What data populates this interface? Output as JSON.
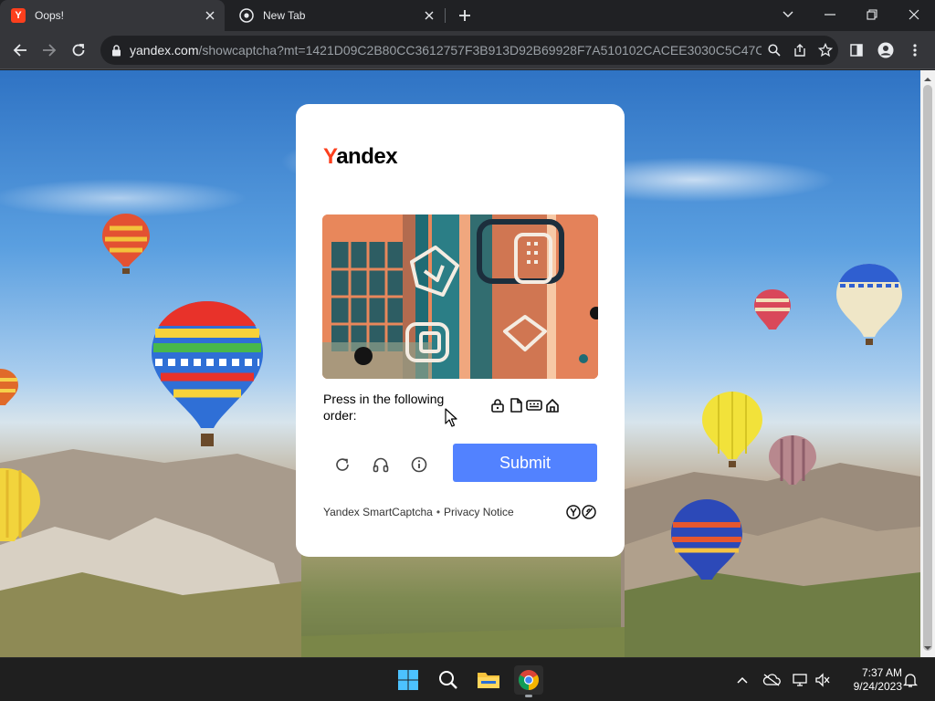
{
  "browser": {
    "tabs": [
      {
        "title": "Oops!",
        "favicon": "yandex-favicon",
        "active": true
      },
      {
        "title": "New Tab",
        "favicon": "chrome-favicon",
        "active": false
      }
    ],
    "url": {
      "host": "yandex.com",
      "path": "/showcaptcha?mt=1421D09C2B80CC3612757F3B913D92B69928F7A510102CACEE3030C5C47C..."
    }
  },
  "card": {
    "brand_first": "Y",
    "brand_rest": "andex",
    "instruction": "Press in the following order:",
    "order_icons": [
      "lock-icon",
      "document-icon",
      "keyboard-icon",
      "house-icon"
    ],
    "submit_label": "Submit",
    "footer_service": "Yandex SmartCaptcha",
    "footer_separator": "•",
    "footer_privacy": "Privacy Notice"
  },
  "taskbar": {
    "apps": [
      "windows-start-icon",
      "search-icon",
      "file-explorer-icon",
      "chrome-icon"
    ],
    "time": "7:37 AM",
    "date": "9/24/2023"
  },
  "colors": {
    "accent_yandex": "#fc3f1d",
    "submit_button": "#5282ff",
    "browser_frame": "#202124",
    "toolbar": "#35363a"
  }
}
